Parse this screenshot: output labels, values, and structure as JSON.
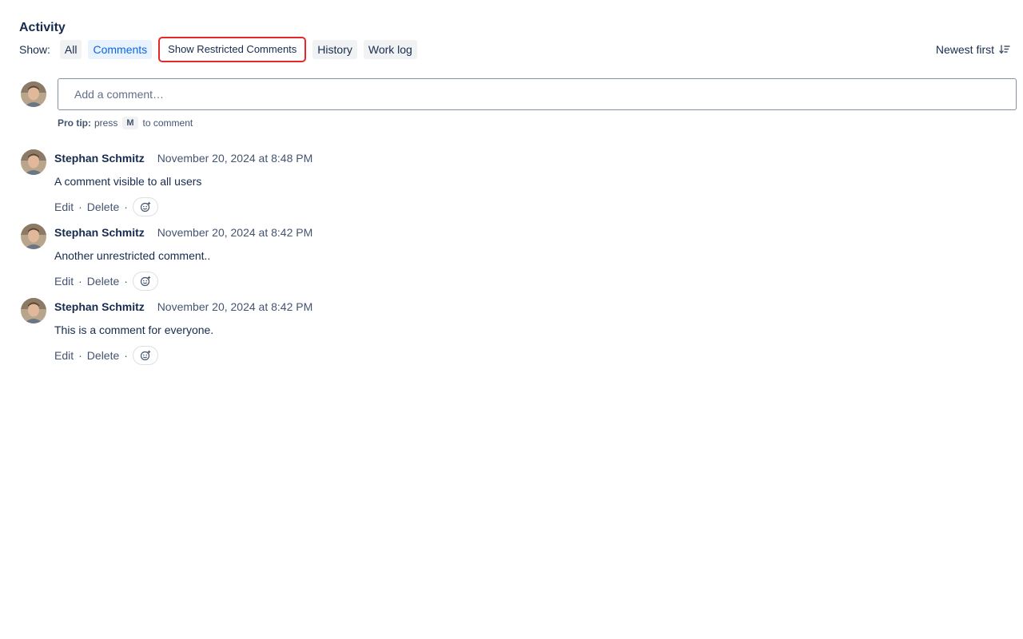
{
  "activity": {
    "heading": "Activity",
    "show_label": "Show:",
    "filters": [
      {
        "label": "All"
      },
      {
        "label": "Comments"
      },
      {
        "label": "Show Restricted Comments"
      },
      {
        "label": "History"
      },
      {
        "label": "Work log"
      }
    ],
    "selected_filter": "Comments",
    "sort_label": "Newest first"
  },
  "composer": {
    "placeholder": "Add a comment…",
    "pro_tip_label": "Pro tip:",
    "pro_tip_press": "press",
    "pro_tip_key": "M",
    "pro_tip_suffix": "to comment"
  },
  "comments": [
    {
      "author": "Stephan Schmitz",
      "timestamp": "November 20, 2024 at 8:48 PM",
      "body": "A comment visible to all users",
      "edit_label": "Edit",
      "delete_label": "Delete",
      "separator": "·"
    },
    {
      "author": "Stephan Schmitz",
      "timestamp": "November 20, 2024 at 8:42 PM",
      "body": "Another unrestricted comment..",
      "edit_label": "Edit",
      "delete_label": "Delete",
      "separator": "·"
    },
    {
      "author": "Stephan Schmitz",
      "timestamp": "November 20, 2024 at 8:42 PM",
      "body": "This is a comment for everyone.",
      "edit_label": "Edit",
      "delete_label": "Delete",
      "separator": "·"
    }
  ],
  "colors": {
    "selected_filter_bg": "#e9f2ff",
    "selected_filter_text": "#0c66e4",
    "highlight_outline": "#e5292b"
  }
}
